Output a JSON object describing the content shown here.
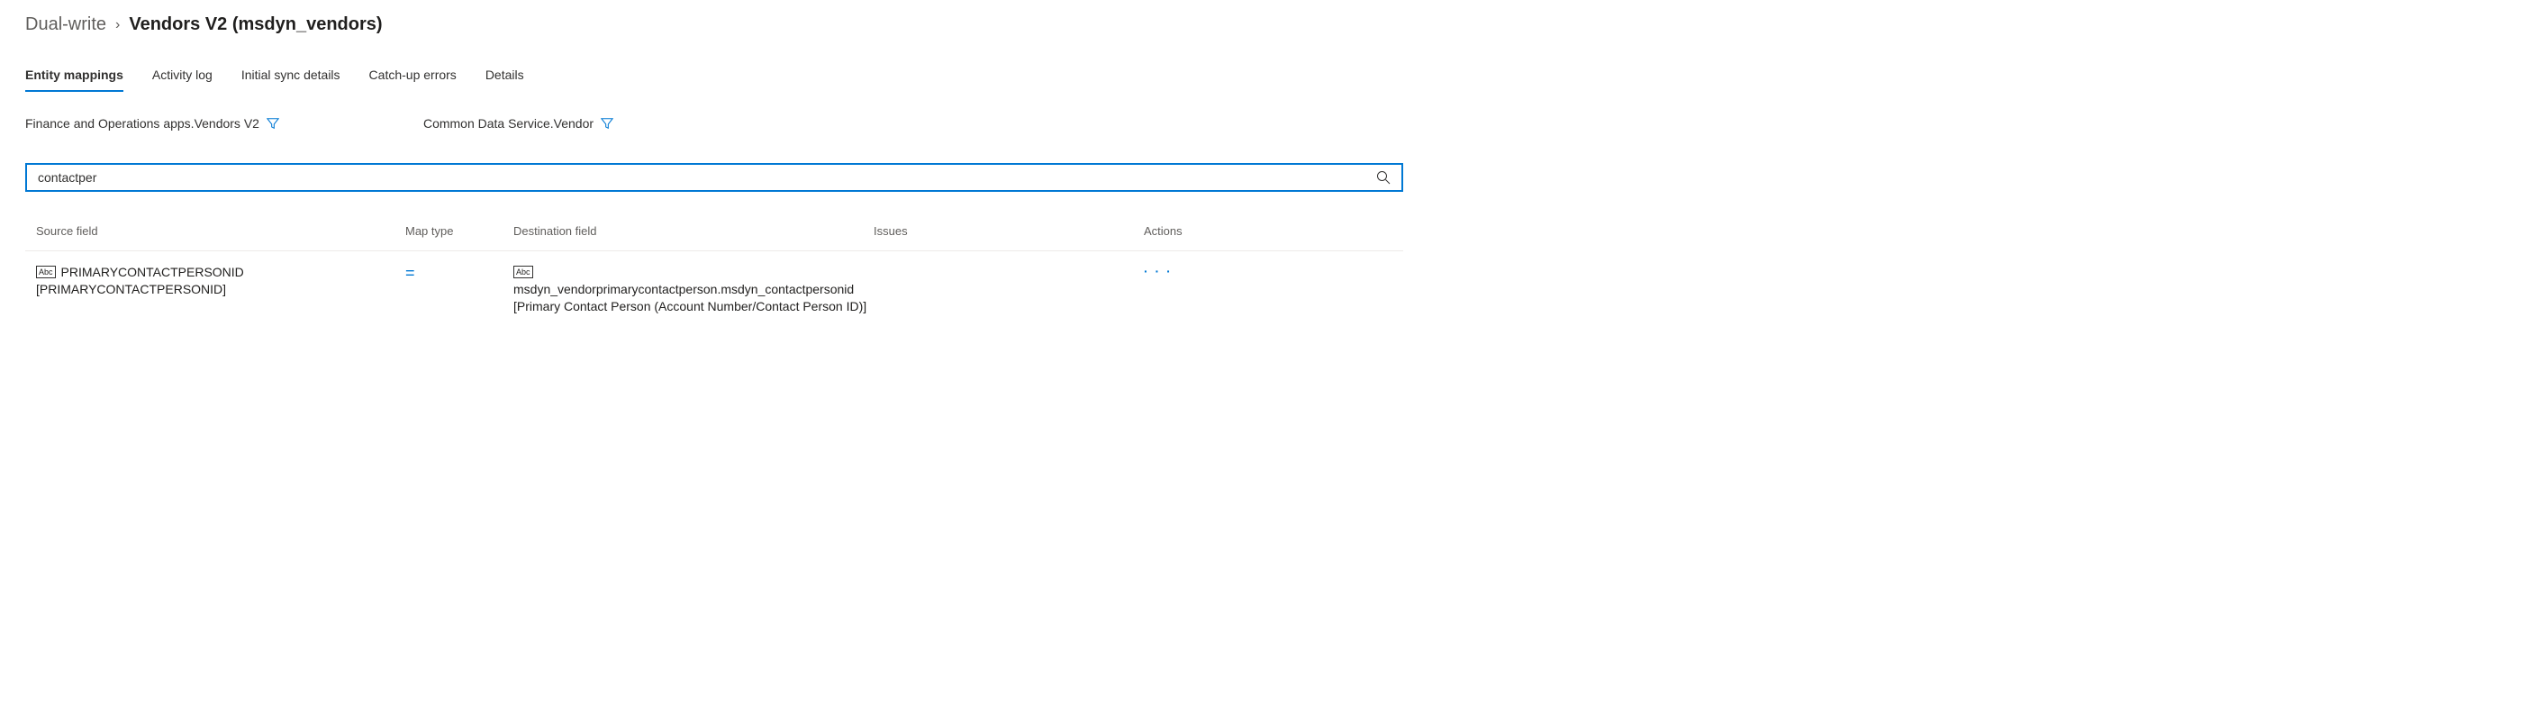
{
  "breadcrumb": {
    "parent": "Dual-write",
    "current": "Vendors V2 (msdyn_vendors)"
  },
  "tabs": [
    {
      "label": "Entity mappings",
      "active": true
    },
    {
      "label": "Activity log",
      "active": false
    },
    {
      "label": "Initial sync details",
      "active": false
    },
    {
      "label": "Catch-up errors",
      "active": false
    },
    {
      "label": "Details",
      "active": false
    }
  ],
  "entities": {
    "left": "Finance and Operations apps.Vendors V2",
    "right": "Common Data Service.Vendor"
  },
  "search": {
    "value": "contactper"
  },
  "table": {
    "headers": {
      "source": "Source field",
      "maptype": "Map type",
      "dest": "Destination field",
      "issues": "Issues",
      "actions": "Actions"
    },
    "rows": [
      {
        "badge": "Abc",
        "source_line1": "PRIMARYCONTACTPERSONID",
        "source_line2": "[PRIMARYCONTACTPERSONID]",
        "maptype": "=",
        "dest_badge": "Abc",
        "dest": "msdyn_vendorprimarycontactperson.msdyn_contactpersonid [Primary Contact Person (Account Number/Contact Person ID)]",
        "issues": "",
        "actions": "· · ·"
      }
    ]
  }
}
